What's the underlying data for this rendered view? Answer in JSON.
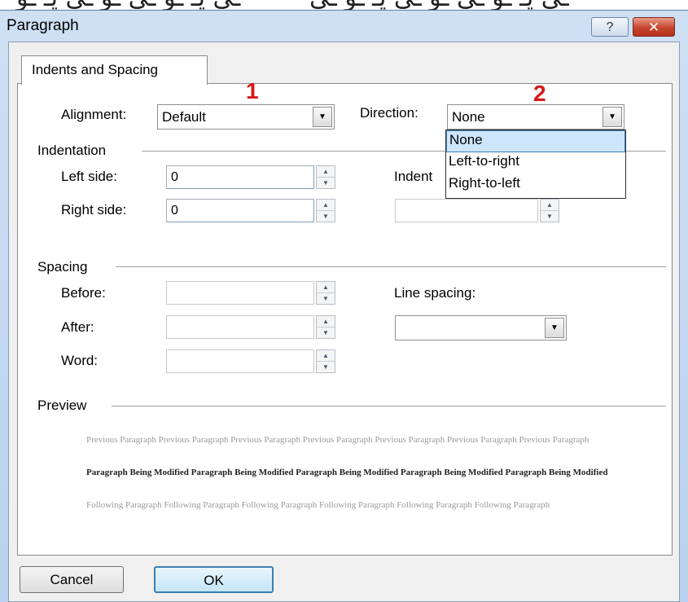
{
  "window": {
    "title": "Paragraph",
    "help_label": "?",
    "close_label": "✕"
  },
  "tab": {
    "label": "Indents and Spacing"
  },
  "general": {
    "alignment_label": "Alignment:",
    "alignment_value": "Default",
    "direction_label": "Direction:",
    "direction_value": "None",
    "direction_options": [
      "None",
      "Left-to-right",
      "Right-to-left"
    ],
    "direction_selected_index": 0
  },
  "markers": {
    "first": "1",
    "second": "2"
  },
  "indentation": {
    "heading": "Indentation",
    "left_label": "Left side:",
    "left_value": "0",
    "right_label": "Right side:",
    "right_value": "0",
    "indent_label": "Indent",
    "indent_value": ""
  },
  "spacing": {
    "heading": "Spacing",
    "before_label": "Before:",
    "after_label": "After:",
    "word_label": "Word:",
    "line_spacing_label": "Line spacing:",
    "line_spacing_value": ""
  },
  "preview": {
    "heading": "Preview",
    "previous": "Previous Paragraph Previous Paragraph Previous Paragraph Previous Paragraph Previous Paragraph Previous Paragraph Previous Paragraph",
    "current": "Paragraph Being Modified Paragraph Being Modified Paragraph Being Modified Paragraph Being Modified Paragraph Being Modified",
    "following": "Following Paragraph Following Paragraph Following Paragraph Following Paragraph Following Paragraph Following Paragraph"
  },
  "buttons": {
    "cancel": "Cancel",
    "ok": "OK"
  },
  "colors": {
    "marker": "#d61a1a",
    "selection": "#cde6fb",
    "title_bar": "#c4d9f1"
  }
}
